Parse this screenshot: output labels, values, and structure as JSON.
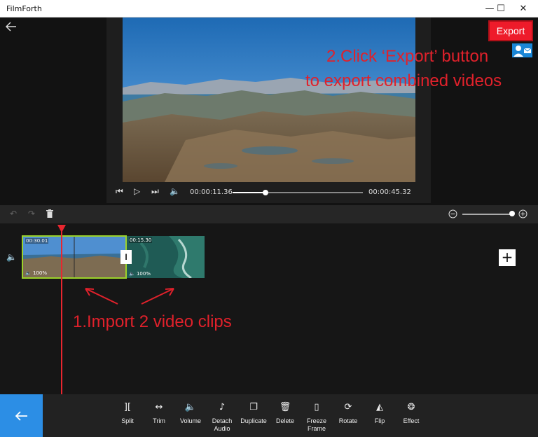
{
  "window": {
    "title": "FilmForth",
    "minimize_glyph": "—",
    "maximize_glyph": "☐",
    "close_glyph": "✕"
  },
  "preview": {
    "back_icon": "arrow-left-icon",
    "current_time": "00:00:11.36",
    "total_time": "00:00:45.32",
    "progress_fraction": 0.25
  },
  "header": {
    "export_label": "Export",
    "account_icon": "account-mail-icon"
  },
  "annotations": {
    "step2_line1": "2.Click ‘Export’ button",
    "step2_line2": "to export combined videos",
    "step1": "1.Import 2 video clips"
  },
  "edit_bar": {
    "undo_icon": "undo-icon",
    "redo_icon": "redo-icon",
    "delete_icon": "trash-icon",
    "zoom_out_icon": "zoom-out-icon",
    "zoom_in_icon": "zoom-in-icon",
    "zoom_fraction": 1.0
  },
  "timeline": {
    "clips": [
      {
        "duration": "00:30.01",
        "volume": "100%",
        "selected": true
      },
      {
        "duration": "00:15.30",
        "volume": "100%",
        "selected": false
      }
    ],
    "add_label": "+",
    "colors": {
      "selection": "#9bd22a",
      "playhead": "#e8262f"
    }
  },
  "toolbar": {
    "back_icon": "arrow-left-icon",
    "tools": [
      {
        "label": "Split",
        "icon": "split-icon"
      },
      {
        "label": "Trim",
        "icon": "trim-icon"
      },
      {
        "label": "Volume",
        "icon": "volume-icon"
      },
      {
        "label": "Detach\nAudio",
        "icon": "detach-audio-icon"
      },
      {
        "label": "Duplicate",
        "icon": "duplicate-icon"
      },
      {
        "label": "Delete",
        "icon": "delete-icon"
      },
      {
        "label": "Freeze\nFrame",
        "icon": "freeze-frame-icon"
      },
      {
        "label": "Rotate",
        "icon": "rotate-icon"
      },
      {
        "label": "Flip",
        "icon": "flip-icon"
      },
      {
        "label": "Effect",
        "icon": "effect-icon"
      }
    ]
  },
  "colors": {
    "accent_blue": "#2c8ee5",
    "export_red": "#ee1b2a",
    "annotation_red": "#e0212b"
  }
}
